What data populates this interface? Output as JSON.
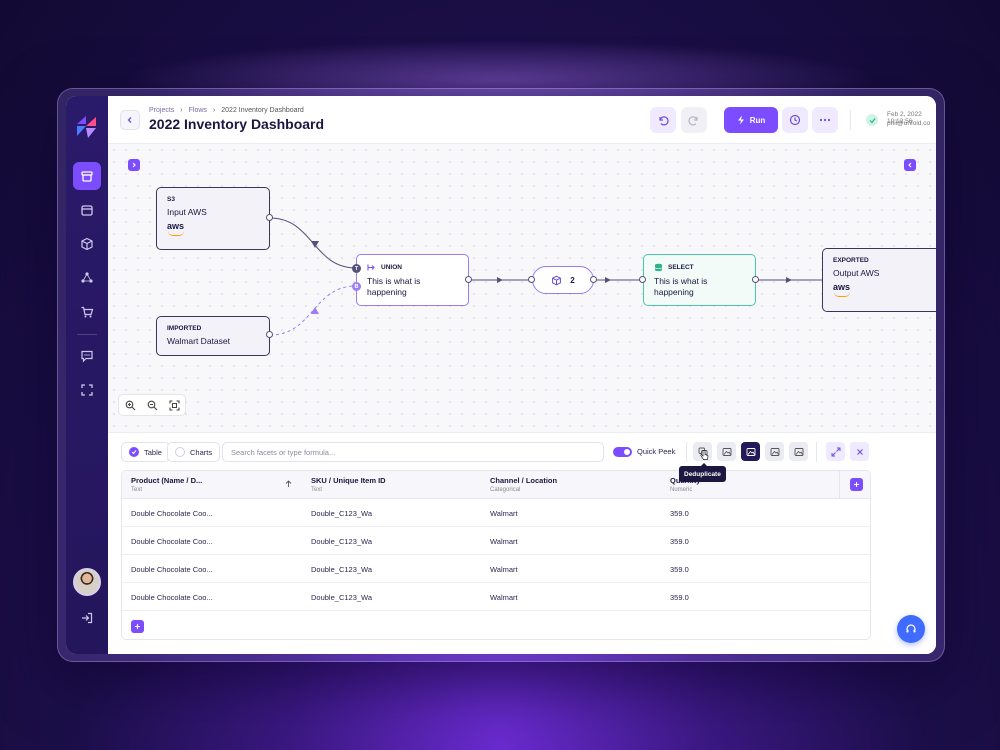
{
  "breadcrumb": {
    "projects": "Projects",
    "flows": "Flows",
    "current": "2022 Inventory Dashboard"
  },
  "header": {
    "title": "2022 Inventory Dashboard",
    "run_label": "Run",
    "status_date": "Feb 2, 2022  10:12:56",
    "status_email": "phil@unfold.co"
  },
  "colors": {
    "accent": "#7c4dff",
    "sidebar": "#24165c",
    "select_green": "#4cc7a1",
    "help_blue": "#3f6bff",
    "aws_orange": "#ff9900"
  },
  "icons": [
    "undo-icon",
    "redo-icon",
    "bolt-icon",
    "clock-icon",
    "more-icon",
    "check-icon",
    "headset-icon"
  ],
  "nodes": {
    "input": {
      "type": "S3",
      "title": "Input AWS",
      "brand": "aws"
    },
    "imported": {
      "type": "IMPORTED",
      "title": "Walmart Dataset"
    },
    "union": {
      "type": "UNION",
      "title": "This is what is happening",
      "port_top": "T",
      "port_bottom": "B"
    },
    "middle": {
      "count": "2"
    },
    "select": {
      "type": "SELECT",
      "title": "This is what is happening"
    },
    "output": {
      "type": "EXPORTED",
      "title": "Output AWS",
      "brand": "aws"
    }
  },
  "panel": {
    "table_tab": "Table",
    "charts_tab": "Charts",
    "search_placeholder": "Search facets or type formula...",
    "quick_peek": "Quick Peek",
    "tooltip": "Deduplicate"
  },
  "table": {
    "columns": [
      {
        "name": "Product (Name / D...",
        "type": "Text"
      },
      {
        "name": "SKU / Unique Item ID",
        "type": "Text"
      },
      {
        "name": "Channel / Location",
        "type": "Categorical"
      },
      {
        "name": "Quantity",
        "type": "Numeric"
      }
    ],
    "rows": [
      [
        "Double Chocolate Coo...",
        "Double_C123_Wa",
        "Walmart",
        "359.0"
      ],
      [
        "Double Chocolate Coo...",
        "Double_C123_Wa",
        "Walmart",
        "359.0"
      ],
      [
        "Double Chocolate Coo...",
        "Double_C123_Wa",
        "Walmart",
        "359.0"
      ],
      [
        "Double Chocolate Coo...",
        "Double_C123_Wa",
        "Walmart",
        "359.0"
      ]
    ]
  }
}
